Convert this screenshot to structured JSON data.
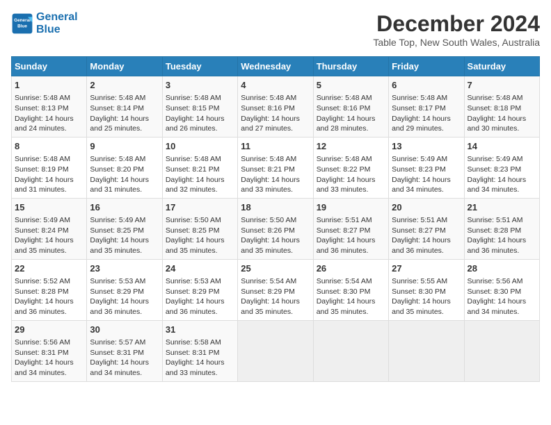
{
  "header": {
    "logo_line1": "General",
    "logo_line2": "Blue",
    "month_title": "December 2024",
    "location": "Table Top, New South Wales, Australia"
  },
  "calendar": {
    "days_of_week": [
      "Sunday",
      "Monday",
      "Tuesday",
      "Wednesday",
      "Thursday",
      "Friday",
      "Saturday"
    ],
    "weeks": [
      [
        {
          "day": "1",
          "info": "Sunrise: 5:48 AM\nSunset: 8:13 PM\nDaylight: 14 hours\nand 24 minutes."
        },
        {
          "day": "2",
          "info": "Sunrise: 5:48 AM\nSunset: 8:14 PM\nDaylight: 14 hours\nand 25 minutes."
        },
        {
          "day": "3",
          "info": "Sunrise: 5:48 AM\nSunset: 8:15 PM\nDaylight: 14 hours\nand 26 minutes."
        },
        {
          "day": "4",
          "info": "Sunrise: 5:48 AM\nSunset: 8:16 PM\nDaylight: 14 hours\nand 27 minutes."
        },
        {
          "day": "5",
          "info": "Sunrise: 5:48 AM\nSunset: 8:16 PM\nDaylight: 14 hours\nand 28 minutes."
        },
        {
          "day": "6",
          "info": "Sunrise: 5:48 AM\nSunset: 8:17 PM\nDaylight: 14 hours\nand 29 minutes."
        },
        {
          "day": "7",
          "info": "Sunrise: 5:48 AM\nSunset: 8:18 PM\nDaylight: 14 hours\nand 30 minutes."
        }
      ],
      [
        {
          "day": "8",
          "info": "Sunrise: 5:48 AM\nSunset: 8:19 PM\nDaylight: 14 hours\nand 31 minutes."
        },
        {
          "day": "9",
          "info": "Sunrise: 5:48 AM\nSunset: 8:20 PM\nDaylight: 14 hours\nand 31 minutes."
        },
        {
          "day": "10",
          "info": "Sunrise: 5:48 AM\nSunset: 8:21 PM\nDaylight: 14 hours\nand 32 minutes."
        },
        {
          "day": "11",
          "info": "Sunrise: 5:48 AM\nSunset: 8:21 PM\nDaylight: 14 hours\nand 33 minutes."
        },
        {
          "day": "12",
          "info": "Sunrise: 5:48 AM\nSunset: 8:22 PM\nDaylight: 14 hours\nand 33 minutes."
        },
        {
          "day": "13",
          "info": "Sunrise: 5:49 AM\nSunset: 8:23 PM\nDaylight: 14 hours\nand 34 minutes."
        },
        {
          "day": "14",
          "info": "Sunrise: 5:49 AM\nSunset: 8:23 PM\nDaylight: 14 hours\nand 34 minutes."
        }
      ],
      [
        {
          "day": "15",
          "info": "Sunrise: 5:49 AM\nSunset: 8:24 PM\nDaylight: 14 hours\nand 35 minutes."
        },
        {
          "day": "16",
          "info": "Sunrise: 5:49 AM\nSunset: 8:25 PM\nDaylight: 14 hours\nand 35 minutes."
        },
        {
          "day": "17",
          "info": "Sunrise: 5:50 AM\nSunset: 8:25 PM\nDaylight: 14 hours\nand 35 minutes."
        },
        {
          "day": "18",
          "info": "Sunrise: 5:50 AM\nSunset: 8:26 PM\nDaylight: 14 hours\nand 35 minutes."
        },
        {
          "day": "19",
          "info": "Sunrise: 5:51 AM\nSunset: 8:27 PM\nDaylight: 14 hours\nand 36 minutes."
        },
        {
          "day": "20",
          "info": "Sunrise: 5:51 AM\nSunset: 8:27 PM\nDaylight: 14 hours\nand 36 minutes."
        },
        {
          "day": "21",
          "info": "Sunrise: 5:51 AM\nSunset: 8:28 PM\nDaylight: 14 hours\nand 36 minutes."
        }
      ],
      [
        {
          "day": "22",
          "info": "Sunrise: 5:52 AM\nSunset: 8:28 PM\nDaylight: 14 hours\nand 36 minutes."
        },
        {
          "day": "23",
          "info": "Sunrise: 5:53 AM\nSunset: 8:29 PM\nDaylight: 14 hours\nand 36 minutes."
        },
        {
          "day": "24",
          "info": "Sunrise: 5:53 AM\nSunset: 8:29 PM\nDaylight: 14 hours\nand 36 minutes."
        },
        {
          "day": "25",
          "info": "Sunrise: 5:54 AM\nSunset: 8:29 PM\nDaylight: 14 hours\nand 35 minutes."
        },
        {
          "day": "26",
          "info": "Sunrise: 5:54 AM\nSunset: 8:30 PM\nDaylight: 14 hours\nand 35 minutes."
        },
        {
          "day": "27",
          "info": "Sunrise: 5:55 AM\nSunset: 8:30 PM\nDaylight: 14 hours\nand 35 minutes."
        },
        {
          "day": "28",
          "info": "Sunrise: 5:56 AM\nSunset: 8:30 PM\nDaylight: 14 hours\nand 34 minutes."
        }
      ],
      [
        {
          "day": "29",
          "info": "Sunrise: 5:56 AM\nSunset: 8:31 PM\nDaylight: 14 hours\nand 34 minutes."
        },
        {
          "day": "30",
          "info": "Sunrise: 5:57 AM\nSunset: 8:31 PM\nDaylight: 14 hours\nand 34 minutes."
        },
        {
          "day": "31",
          "info": "Sunrise: 5:58 AM\nSunset: 8:31 PM\nDaylight: 14 hours\nand 33 minutes."
        },
        {
          "day": "",
          "info": ""
        },
        {
          "day": "",
          "info": ""
        },
        {
          "day": "",
          "info": ""
        },
        {
          "day": "",
          "info": ""
        }
      ]
    ]
  }
}
